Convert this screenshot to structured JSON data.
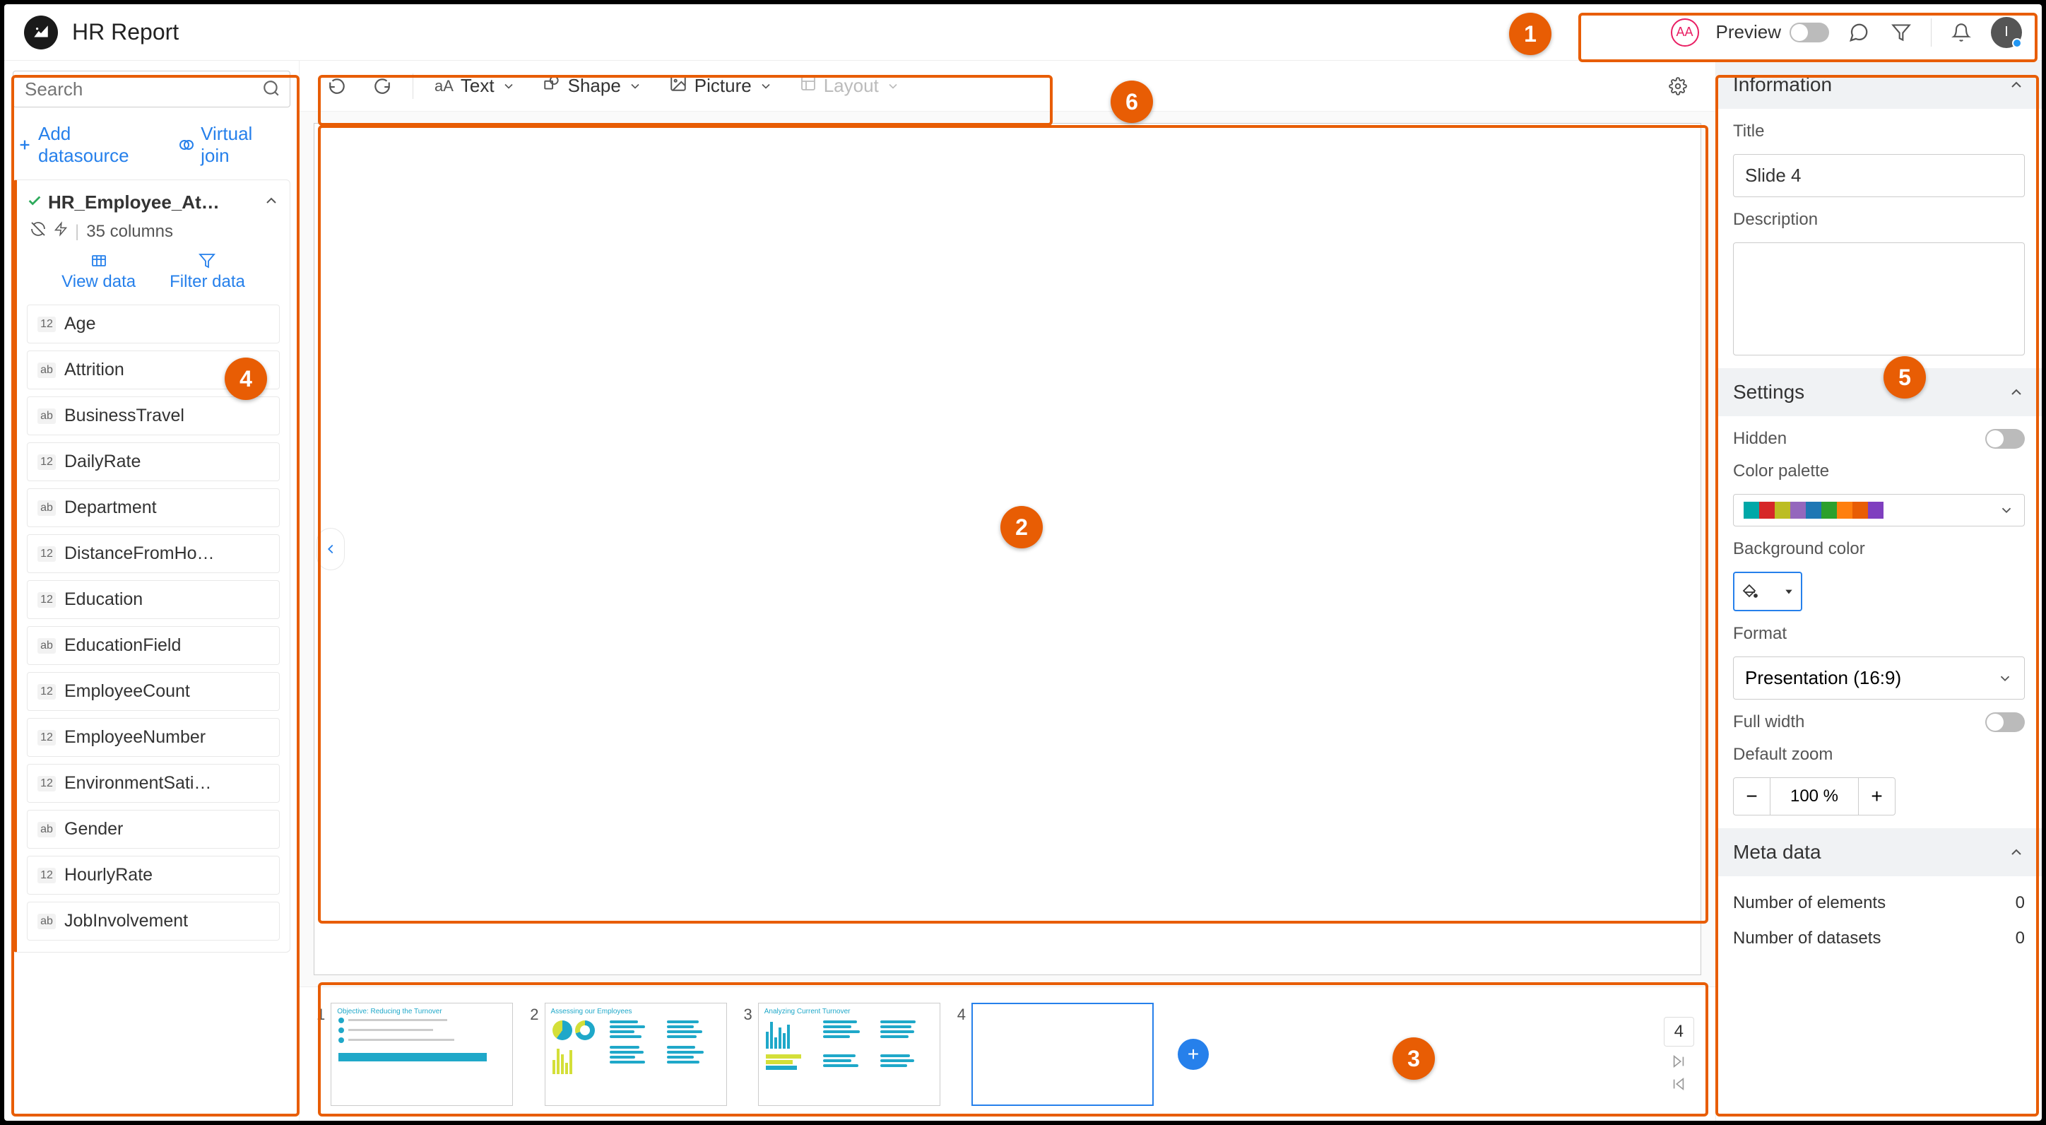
{
  "header": {
    "title": "HR Report",
    "user_initials": "AA",
    "preview_label": "Preview",
    "avatar_initial": "I"
  },
  "search": {
    "placeholder": "Search"
  },
  "sidebar": {
    "add_datasource": "Add datasource",
    "virtual_join": "Virtual join",
    "datasource": {
      "name": "HR_Employee_At…",
      "columns_label": "35 columns",
      "view_data": "View data",
      "filter_data": "Filter data"
    },
    "fields": [
      {
        "type": "12",
        "name": "Age"
      },
      {
        "type": "ab",
        "name": "Attrition"
      },
      {
        "type": "ab",
        "name": "BusinessTravel"
      },
      {
        "type": "12",
        "name": "DailyRate"
      },
      {
        "type": "ab",
        "name": "Department"
      },
      {
        "type": "12",
        "name": "DistanceFromHo…"
      },
      {
        "type": "12",
        "name": "Education"
      },
      {
        "type": "ab",
        "name": "EducationField"
      },
      {
        "type": "12",
        "name": "EmployeeCount"
      },
      {
        "type": "12",
        "name": "EmployeeNumber"
      },
      {
        "type": "12",
        "name": "EnvironmentSati…"
      },
      {
        "type": "ab",
        "name": "Gender"
      },
      {
        "type": "12",
        "name": "HourlyRate"
      },
      {
        "type": "ab",
        "name": "JobInvolvement"
      }
    ]
  },
  "toolbar": {
    "text": "Text",
    "shape": "Shape",
    "picture": "Picture",
    "layout": "Layout"
  },
  "thumbs": {
    "count": "4",
    "slides": [
      {
        "num": "1",
        "title": "Objective: Reducing the Turnover"
      },
      {
        "num": "2",
        "title": "Assessing our Employees"
      },
      {
        "num": "3",
        "title": "Analyzing Current Turnover"
      },
      {
        "num": "4",
        "title": ""
      }
    ]
  },
  "rightPanel": {
    "information_header": "Information",
    "title_label": "Title",
    "title_value": "Slide 4",
    "description_label": "Description",
    "settings_header": "Settings",
    "hidden_label": "Hidden",
    "palette_label": "Color palette",
    "bg_label": "Background color",
    "format_label": "Format",
    "format_value": "Presentation (16:9)",
    "full_width_label": "Full width",
    "zoom_label": "Default zoom",
    "zoom_value": "100 %",
    "meta_header": "Meta data",
    "num_elements_label": "Number of elements",
    "num_elements_val": "0",
    "num_datasets_label": "Number of datasets",
    "num_datasets_val": "0"
  },
  "palette_colors": [
    "#00A8A8",
    "#D62728",
    "#BCBD22",
    "#9467BD",
    "#1F77B4",
    "#2CA02C",
    "#FF7F0E",
    "#E85D04",
    "#7F3FBF"
  ],
  "annotations": {
    "b1": "1",
    "b2": "2",
    "b3": "3",
    "b4": "4",
    "b5": "5",
    "b6": "6"
  }
}
